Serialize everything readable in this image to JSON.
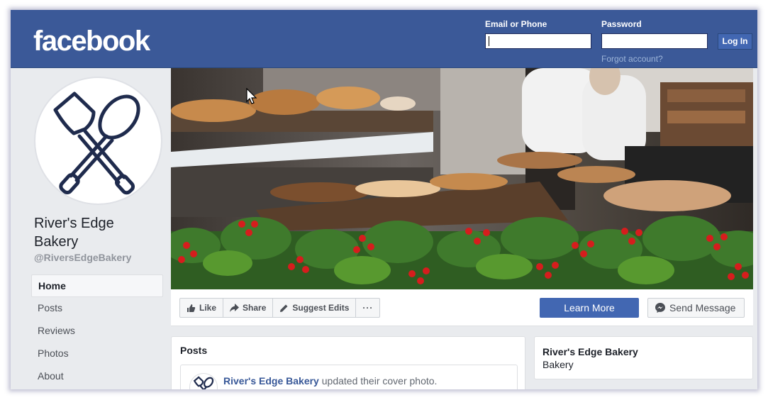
{
  "header": {
    "logo_text": "facebook",
    "email_label": "Email or Phone",
    "password_label": "Password",
    "email_value": "",
    "password_value": "",
    "login_label": "Log In",
    "forgot_label": "Forgot account?",
    "brand_color": "#3b5998"
  },
  "sidebar": {
    "page_name": "River's Edge Bakery",
    "handle": "@RiversEdgeBakery",
    "avatar_icon": "crossed-spatula-spoon-icon",
    "items": [
      {
        "label": "Home",
        "active": true
      },
      {
        "label": "Posts",
        "active": false
      },
      {
        "label": "Reviews",
        "active": false
      },
      {
        "label": "Photos",
        "active": false
      },
      {
        "label": "About",
        "active": false
      }
    ]
  },
  "cover": {
    "description_icon": "bakery-display-cover-photo"
  },
  "actions": {
    "like_label": "Like",
    "share_label": "Share",
    "suggest_label": "Suggest Edits",
    "more_label": "···",
    "learn_more_label": "Learn More",
    "send_message_label": "Send Message",
    "accent_color": "#4267b2"
  },
  "posts": {
    "title": "Posts",
    "items": [
      {
        "author": "River's Edge Bakery",
        "text": " updated their cover photo."
      }
    ]
  },
  "about": {
    "name": "River's Edge Bakery",
    "category": "Bakery"
  }
}
